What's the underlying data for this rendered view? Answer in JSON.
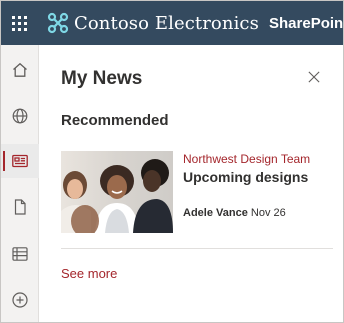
{
  "suitebar": {
    "brand_name": "Contoso Electronics",
    "app_name": "SharePoint",
    "background": "#344a5f",
    "logo_icon": "contoso-logo"
  },
  "rail": {
    "items": [
      {
        "name": "home",
        "icon": "home-icon",
        "active": false
      },
      {
        "name": "sites",
        "icon": "globe-icon",
        "active": false
      },
      {
        "name": "news",
        "icon": "news-icon",
        "active": true
      },
      {
        "name": "files",
        "icon": "document-icon",
        "active": false
      },
      {
        "name": "lists",
        "icon": "list-icon",
        "active": false
      },
      {
        "name": "create",
        "icon": "add-circle-icon",
        "active": false
      }
    ],
    "accent": "#a4262c"
  },
  "panel": {
    "title": "My News",
    "close_icon": "close-icon",
    "section_title": "Recommended",
    "news": [
      {
        "source": "Northwest Design Team",
        "title": "Upcoming designs",
        "author": "Adele Vance",
        "date": "Nov 26"
      }
    ],
    "see_more": "See more"
  }
}
